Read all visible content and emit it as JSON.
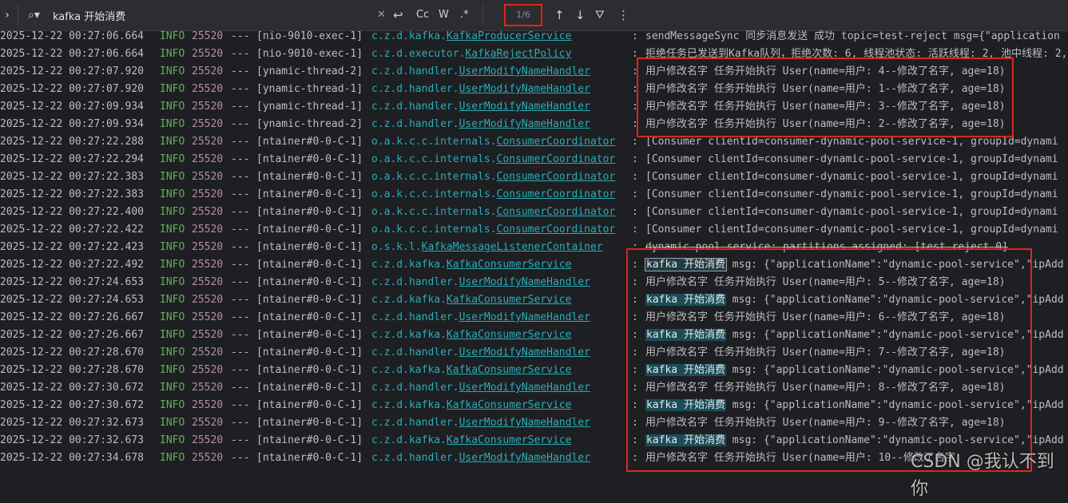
{
  "search": {
    "query": "kafka 开始消费",
    "match_count": "1/6",
    "case_label": "Cc",
    "word_label": "W",
    "regex_label": ".*",
    "icons": [
      "chevron-right-icon",
      "search-icon",
      "clear-icon",
      "wrap-icon",
      "arrow-up-icon",
      "arrow-down-icon",
      "filter-icon",
      "more-icon"
    ]
  },
  "colors": {
    "info": "#5fb257",
    "pid": "#b48ead",
    "logger": "#2aacb8",
    "highlight_box": "#e0241b",
    "search_match": "#1a4d57"
  },
  "log_lines": [
    {
      "time": "2025-12-22 00:27:06.664",
      "level": "INFO",
      "pid": "25520",
      "dash": "---",
      "thread": "[nio-9010-exec-1]",
      "logger_pkg": "c.z.d.kafka.",
      "logger_cls": "KafkaProducerService",
      "msg": "sendMessageSync 同步消息发送 成功 topic=test-reject msg={\"application"
    },
    {
      "time": "2025-12-22 00:27:06.664",
      "level": "INFO",
      "pid": "25520",
      "dash": "---",
      "thread": "[nio-9010-exec-1]",
      "logger_pkg": "c.z.d.executor.",
      "logger_cls": "KafkaRejectPolicy",
      "msg": "拒绝任务已发送到Kafka队列，拒绝次数: 6, 线程池状态: 活跃线程: 2, 池中线程: 2,"
    },
    {
      "time": "2025-12-22 00:27:07.920",
      "level": "INFO",
      "pid": "25520",
      "dash": "---",
      "thread": "[ynamic-thread-2]",
      "logger_pkg": "c.z.d.handler.",
      "logger_cls": "UserModifyNameHandler",
      "msg": "用户修改名字 任务开始执行 User(name=用户: 4--修改了名字, age=18)"
    },
    {
      "time": "2025-12-22 00:27:07.920",
      "level": "INFO",
      "pid": "25520",
      "dash": "---",
      "thread": "[ynamic-thread-1]",
      "logger_pkg": "c.z.d.handler.",
      "logger_cls": "UserModifyNameHandler",
      "msg": "用户修改名字 任务开始执行 User(name=用户: 1--修改了名字, age=18)"
    },
    {
      "time": "2025-12-22 00:27:09.934",
      "level": "INFO",
      "pid": "25520",
      "dash": "---",
      "thread": "[ynamic-thread-1]",
      "logger_pkg": "c.z.d.handler.",
      "logger_cls": "UserModifyNameHandler",
      "msg": "用户修改名字 任务开始执行 User(name=用户: 3--修改了名字, age=18)"
    },
    {
      "time": "2025-12-22 00:27:09.934",
      "level": "INFO",
      "pid": "25520",
      "dash": "---",
      "thread": "[ynamic-thread-2]",
      "logger_pkg": "c.z.d.handler.",
      "logger_cls": "UserModifyNameHandler",
      "msg": "用户修改名字 任务开始执行 User(name=用户: 2--修改了名字, age=18)"
    },
    {
      "time": "2025-12-22 00:27:22.288",
      "level": "INFO",
      "pid": "25520",
      "dash": "---",
      "thread": "[ntainer#0-0-C-1]",
      "logger_pkg": "o.a.k.c.c.internals.",
      "logger_cls": "ConsumerCoordinator",
      "msg": "[Consumer clientId=consumer-dynamic-pool-service-1, groupId=dynami"
    },
    {
      "time": "2025-12-22 00:27:22.294",
      "level": "INFO",
      "pid": "25520",
      "dash": "---",
      "thread": "[ntainer#0-0-C-1]",
      "logger_pkg": "o.a.k.c.c.internals.",
      "logger_cls": "ConsumerCoordinator",
      "msg": "[Consumer clientId=consumer-dynamic-pool-service-1, groupId=dynami"
    },
    {
      "time": "2025-12-22 00:27:22.383",
      "level": "INFO",
      "pid": "25520",
      "dash": "---",
      "thread": "[ntainer#0-0-C-1]",
      "logger_pkg": "o.a.k.c.c.internals.",
      "logger_cls": "ConsumerCoordinator",
      "msg": "[Consumer clientId=consumer-dynamic-pool-service-1, groupId=dynami"
    },
    {
      "time": "2025-12-22 00:27:22.383",
      "level": "INFO",
      "pid": "25520",
      "dash": "---",
      "thread": "[ntainer#0-0-C-1]",
      "logger_pkg": "o.a.k.c.c.internals.",
      "logger_cls": "ConsumerCoordinator",
      "msg": "[Consumer clientId=consumer-dynamic-pool-service-1, groupId=dynami"
    },
    {
      "time": "2025-12-22 00:27:22.400",
      "level": "INFO",
      "pid": "25520",
      "dash": "---",
      "thread": "[ntainer#0-0-C-1]",
      "logger_pkg": "o.a.k.c.c.internals.",
      "logger_cls": "ConsumerCoordinator",
      "msg": "[Consumer clientId=consumer-dynamic-pool-service-1, groupId=dynami"
    },
    {
      "time": "2025-12-22 00:27:22.422",
      "level": "INFO",
      "pid": "25520",
      "dash": "---",
      "thread": "[ntainer#0-0-C-1]",
      "logger_pkg": "o.a.k.c.c.internals.",
      "logger_cls": "ConsumerCoordinator",
      "msg": "[Consumer clientId=consumer-dynamic-pool-service-1, groupId=dynami"
    },
    {
      "time": "2025-12-22 00:27:22.423",
      "level": "INFO",
      "pid": "25520",
      "dash": "---",
      "thread": "[ntainer#0-0-C-1]",
      "logger_pkg": "o.s.k.l.",
      "logger_cls": "KafkaMessageListenerContainer",
      "msg": "dynamic-pool-service: partitions assigned: [test-reject-0]"
    },
    {
      "time": "2025-12-22 00:27:22.492",
      "level": "INFO",
      "pid": "25520",
      "dash": "---",
      "thread": "[ntainer#0-0-C-1]",
      "logger_pkg": "c.z.d.kafka.",
      "logger_cls": "KafkaConsumerService",
      "match": "kafka 开始消费",
      "match_current": true,
      "msg": " msg: {\"applicationName\":\"dynamic-pool-service\",\"ipAdd"
    },
    {
      "time": "2025-12-22 00:27:24.653",
      "level": "INFO",
      "pid": "25520",
      "dash": "---",
      "thread": "[ntainer#0-0-C-1]",
      "logger_pkg": "c.z.d.handler.",
      "logger_cls": "UserModifyNameHandler",
      "msg": "用户修改名字 任务开始执行 User(name=用户: 5--修改了名字, age=18)"
    },
    {
      "time": "2025-12-22 00:27:24.653",
      "level": "INFO",
      "pid": "25520",
      "dash": "---",
      "thread": "[ntainer#0-0-C-1]",
      "logger_pkg": "c.z.d.kafka.",
      "logger_cls": "KafkaConsumerService",
      "match": "kafka 开始消费",
      "msg": " msg: {\"applicationName\":\"dynamic-pool-service\",\"ipAdd"
    },
    {
      "time": "2025-12-22 00:27:26.667",
      "level": "INFO",
      "pid": "25520",
      "dash": "---",
      "thread": "[ntainer#0-0-C-1]",
      "logger_pkg": "c.z.d.handler.",
      "logger_cls": "UserModifyNameHandler",
      "msg": "用户修改名字 任务开始执行 User(name=用户: 6--修改了名字, age=18)"
    },
    {
      "time": "2025-12-22 00:27:26.667",
      "level": "INFO",
      "pid": "25520",
      "dash": "---",
      "thread": "[ntainer#0-0-C-1]",
      "logger_pkg": "c.z.d.kafka.",
      "logger_cls": "KafkaConsumerService",
      "match": "kafka 开始消费",
      "msg": " msg: {\"applicationName\":\"dynamic-pool-service\",\"ipAdd"
    },
    {
      "time": "2025-12-22 00:27:28.670",
      "level": "INFO",
      "pid": "25520",
      "dash": "---",
      "thread": "[ntainer#0-0-C-1]",
      "logger_pkg": "c.z.d.handler.",
      "logger_cls": "UserModifyNameHandler",
      "msg": "用户修改名字 任务开始执行 User(name=用户: 7--修改了名字, age=18)"
    },
    {
      "time": "2025-12-22 00:27:28.670",
      "level": "INFO",
      "pid": "25520",
      "dash": "---",
      "thread": "[ntainer#0-0-C-1]",
      "logger_pkg": "c.z.d.kafka.",
      "logger_cls": "KafkaConsumerService",
      "match": "kafka 开始消费",
      "msg": " msg: {\"applicationName\":\"dynamic-pool-service\",\"ipAdd"
    },
    {
      "time": "2025-12-22 00:27:30.672",
      "level": "INFO",
      "pid": "25520",
      "dash": "---",
      "thread": "[ntainer#0-0-C-1]",
      "logger_pkg": "c.z.d.handler.",
      "logger_cls": "UserModifyNameHandler",
      "msg": "用户修改名字 任务开始执行 User(name=用户: 8--修改了名字, age=18)"
    },
    {
      "time": "2025-12-22 00:27:30.672",
      "level": "INFO",
      "pid": "25520",
      "dash": "---",
      "thread": "[ntainer#0-0-C-1]",
      "logger_pkg": "c.z.d.kafka.",
      "logger_cls": "KafkaConsumerService",
      "match": "kafka 开始消费",
      "msg": " msg: {\"applicationName\":\"dynamic-pool-service\",\"ipAdd"
    },
    {
      "time": "2025-12-22 00:27:32.673",
      "level": "INFO",
      "pid": "25520",
      "dash": "---",
      "thread": "[ntainer#0-0-C-1]",
      "logger_pkg": "c.z.d.handler.",
      "logger_cls": "UserModifyNameHandler",
      "msg": "用户修改名字 任务开始执行 User(name=用户: 9--修改了名字, age=18)"
    },
    {
      "time": "2025-12-22 00:27:32.673",
      "level": "INFO",
      "pid": "25520",
      "dash": "---",
      "thread": "[ntainer#0-0-C-1]",
      "logger_pkg": "c.z.d.kafka.",
      "logger_cls": "KafkaConsumerService",
      "match": "kafka 开始消费",
      "msg": " msg: {\"applicationName\":\"dynamic-pool-service\",\"ipAdd"
    },
    {
      "time": "2025-12-22 00:27:34.678",
      "level": "INFO",
      "pid": "25520",
      "dash": "---",
      "thread": "[ntainer#0-0-C-1]",
      "logger_pkg": "c.z.d.handler.",
      "logger_cls": "UserModifyNameHandler",
      "msg": "用户修改名字 任务开始执行 User(name=用户: 10--修改了名字"
    }
  ],
  "colon": ":",
  "watermark": "CSDN @我认不到你"
}
